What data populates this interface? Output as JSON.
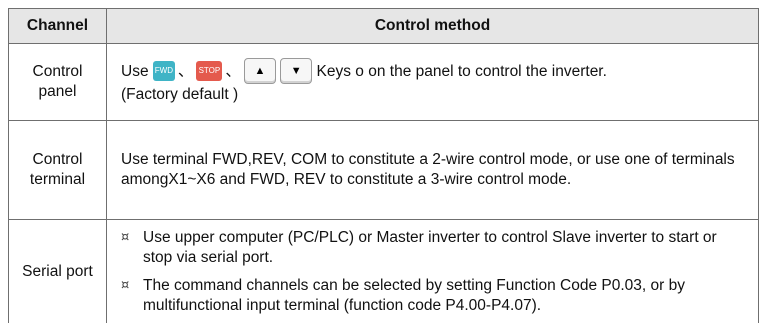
{
  "table": {
    "headers": [
      "Channel",
      "Control method"
    ],
    "rows": [
      {
        "channel": "Control panel",
        "keys": {
          "prefix": "Use",
          "fwd": "FWD",
          "stop": "STOP",
          "up": "▲",
          "down": "▼",
          "separator": "、",
          "suffix": "Keys o on the panel to control the inverter.",
          "note": "(Factory default )"
        }
      },
      {
        "channel": "Control terminal",
        "text": "Use terminal FWD,REV, COM to constitute a 2-wire control mode, or use one of terminals amongX1~X6 and FWD, REV to constitute a 3-wire control mode."
      },
      {
        "channel": "Serial port",
        "bullet_mark": "¤",
        "bullets": [
          "Use upper computer (PC/PLC) or Master inverter to control Slave inverter to start or stop via serial port.",
          "The command channels can be selected by setting Function Code P0.03, or by multifunctional input terminal (function code P4.00-P4.07)."
        ]
      }
    ]
  },
  "colors": {
    "header_bg": "#e6e6e6",
    "border": "#6f6f6f",
    "fwd_key": "#3fb4c6",
    "stop_key": "#e45a4d"
  }
}
